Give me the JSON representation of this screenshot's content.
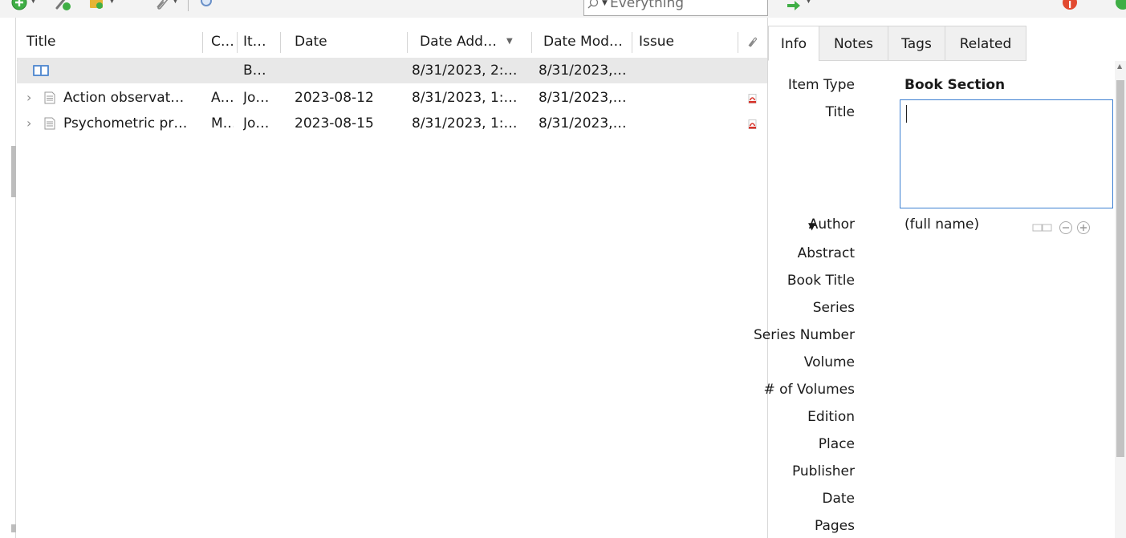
{
  "toolbar": {
    "search_placeholder": "Everything",
    "colors": {
      "accent_green": "#3fae45",
      "alert_red": "#e24a30",
      "folder_yellow": "#e7b436"
    }
  },
  "items": {
    "columns": [
      "Title",
      "C…",
      "It…",
      "Date",
      "Date Add…",
      "Date Mod…",
      "Issue"
    ],
    "rows": [
      {
        "title": "",
        "creator": "",
        "type": "B…",
        "date": "",
        "date_added": "8/31/2023, 2:…",
        "date_modified": "8/31/2023,…",
        "issue": "",
        "has_pdf": false
      },
      {
        "title": "Action observat…",
        "creator": "A…",
        "type": "Jo…",
        "date": "2023-08-12",
        "date_added": "8/31/2023, 1:…",
        "date_modified": "8/31/2023,…",
        "issue": "",
        "has_pdf": true
      },
      {
        "title": "Psychometric pr…",
        "creator": "M…",
        "type": "Jo…",
        "date": "2023-08-15",
        "date_added": "8/31/2023, 1:…",
        "date_modified": "8/31/2023,…",
        "issue": "",
        "has_pdf": true
      }
    ]
  },
  "pane": {
    "tabs": [
      "Info",
      "Notes",
      "Tags",
      "Related"
    ],
    "fields": {
      "item_type_label": "Item Type",
      "item_type_value": "Book Section",
      "title_label": "Title",
      "title_value": "",
      "author_label": "Author",
      "author_value": "(full name)",
      "labels": [
        "Abstract",
        "Book Title",
        "Series",
        "Series Number",
        "Volume",
        "# of Volumes",
        "Edition",
        "Place",
        "Publisher",
        "Date",
        "Pages"
      ]
    }
  }
}
